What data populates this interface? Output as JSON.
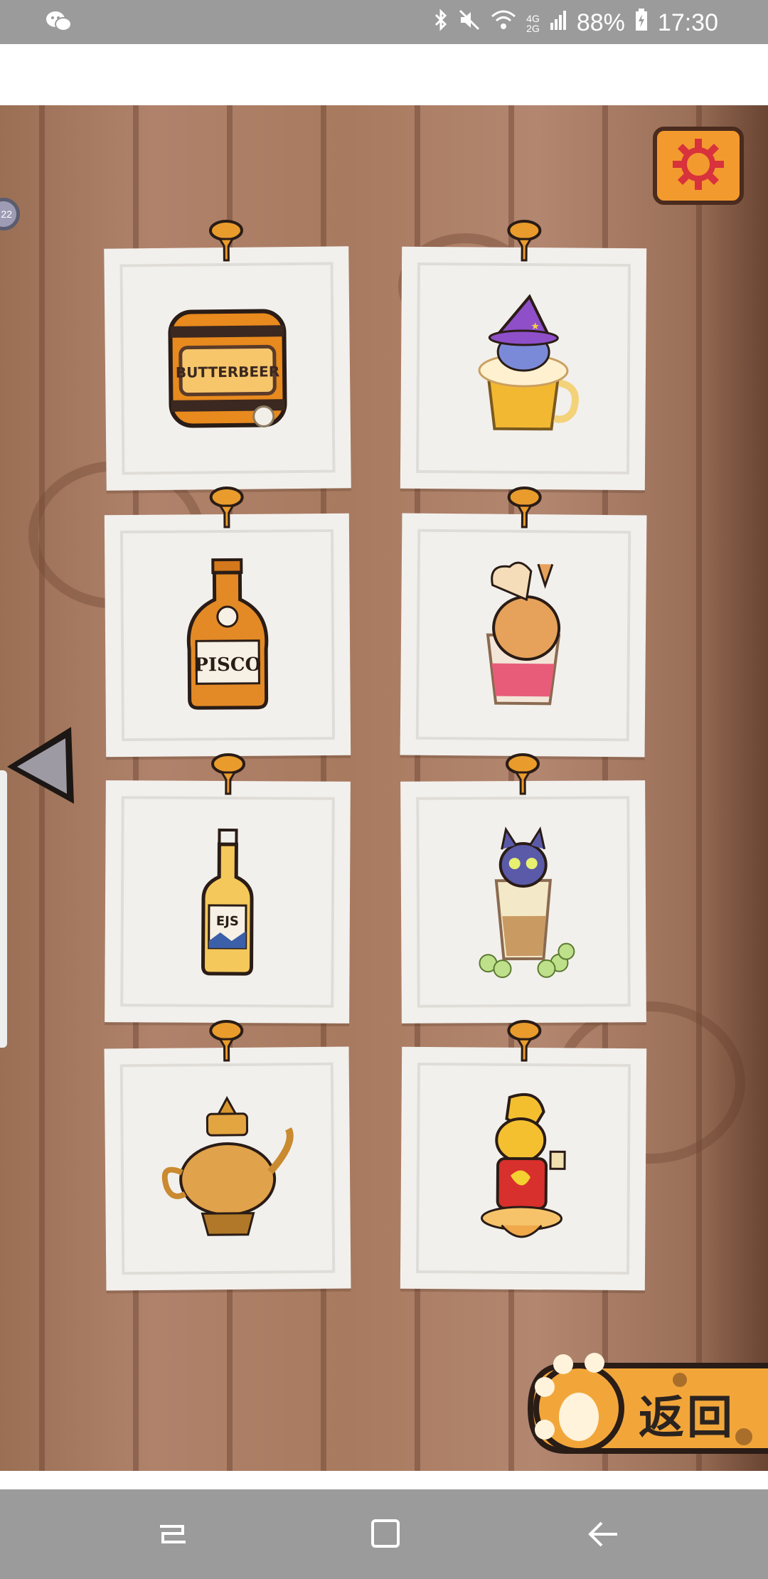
{
  "status_bar": {
    "left_icon": "wechat-icon",
    "network_top": "4G",
    "network_bottom": "2G",
    "battery": "88%",
    "time": "17:30",
    "icons": [
      "bluetooth-icon",
      "mute-icon",
      "wifi-icon",
      "signal-icon",
      "battery-charging-icon"
    ]
  },
  "side_badge": {
    "text": "22"
  },
  "cards": [
    {
      "name": "butterbeer",
      "art_text": "BUTTERBEER",
      "icon": "butterbeer-barrel-icon"
    },
    {
      "name": "wizard-cat-mug",
      "art_text": "",
      "icon": "wizard-cat-beer-mug-icon"
    },
    {
      "name": "pisco",
      "art_text": "PISCO",
      "icon": "pisco-bottle-icon"
    },
    {
      "name": "llama-cat-glass",
      "art_text": "",
      "icon": "llama-cat-glass-icon"
    },
    {
      "name": "tequila-bottle",
      "art_text": "EJS",
      "icon": "liquor-bottle-icon"
    },
    {
      "name": "grape-cat-glass",
      "art_text": "",
      "icon": "cat-grape-glass-icon"
    },
    {
      "name": "teapot",
      "art_text": "",
      "icon": "golden-teapot-icon"
    },
    {
      "name": "king-cat-drink",
      "art_text": "",
      "icon": "king-cat-drink-icon"
    }
  ],
  "back_button": {
    "label": "返回"
  },
  "nav_bar": {
    "items": [
      "recent-apps-icon",
      "home-icon",
      "back-icon"
    ]
  },
  "colors": {
    "wood": "#a87a5f",
    "settings_orange": "#f39a2e",
    "paw_orange": "#f2a63a",
    "status_gray": "#9b9b9b"
  }
}
